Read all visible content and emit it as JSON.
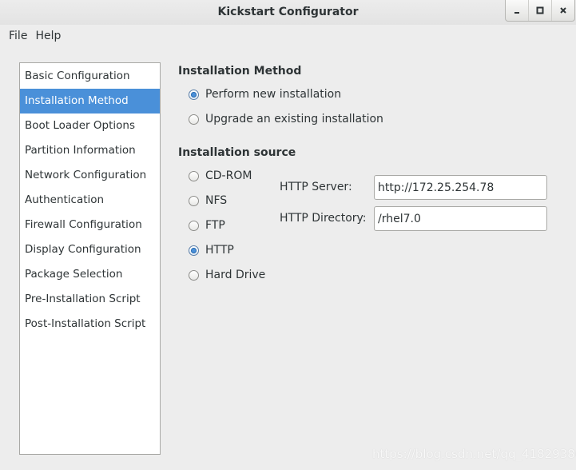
{
  "window": {
    "title": "Kickstart Configurator"
  },
  "menubar": {
    "items": [
      {
        "label": "File"
      },
      {
        "label": "Help"
      }
    ]
  },
  "sidebar": {
    "items": [
      {
        "label": "Basic Configuration",
        "selected": false
      },
      {
        "label": "Installation Method",
        "selected": true
      },
      {
        "label": "Boot Loader Options",
        "selected": false
      },
      {
        "label": "Partition Information",
        "selected": false
      },
      {
        "label": "Network Configuration",
        "selected": false
      },
      {
        "label": "Authentication",
        "selected": false
      },
      {
        "label": "Firewall Configuration",
        "selected": false
      },
      {
        "label": "Display Configuration",
        "selected": false
      },
      {
        "label": "Package Selection",
        "selected": false
      },
      {
        "label": "Pre-Installation Script",
        "selected": false
      },
      {
        "label": "Post-Installation Script",
        "selected": false
      }
    ]
  },
  "installation_method": {
    "title": "Installation Method",
    "options": [
      {
        "label": "Perform new installation",
        "checked": true
      },
      {
        "label": "Upgrade an existing installation",
        "checked": false
      }
    ]
  },
  "installation_source": {
    "title": "Installation source",
    "options": [
      {
        "label": "CD-ROM",
        "checked": false
      },
      {
        "label": "NFS",
        "checked": false
      },
      {
        "label": "FTP",
        "checked": false
      },
      {
        "label": "HTTP",
        "checked": true
      },
      {
        "label": "Hard Drive",
        "checked": false
      }
    ],
    "http_server_label": "HTTP Server:",
    "http_server_value": "http://172.25.254.78",
    "http_directory_label": "HTTP Directory:",
    "http_directory_value": "/rhel7.0"
  },
  "watermark": "https://blog.csdn.net/qq_41829386",
  "colors": {
    "selection": "#4a90d9",
    "window_bg": "#ededed"
  }
}
